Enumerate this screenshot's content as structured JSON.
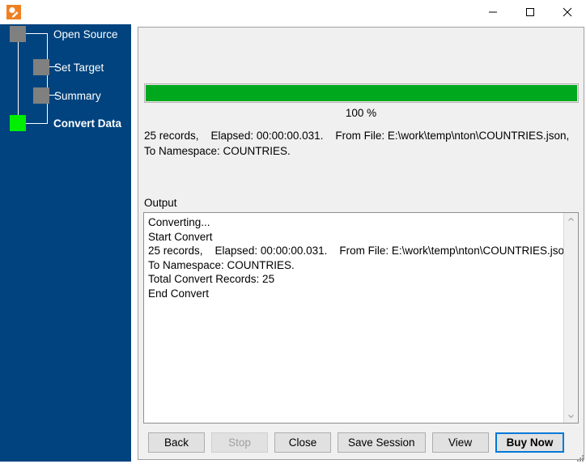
{
  "window": {
    "title": "",
    "icon": "app-edit-icon",
    "controls": {
      "minimize": "minimize-icon",
      "maximize": "maximize-icon",
      "close": "close-icon"
    }
  },
  "sidebar": {
    "background_color": "#00437e",
    "items": [
      {
        "label": "Open Source",
        "state": "done",
        "color": "#808080"
      },
      {
        "label": "Set Target",
        "state": "done",
        "color": "#808080"
      },
      {
        "label": "Summary",
        "state": "done",
        "color": "#808080"
      },
      {
        "label": "Convert Data",
        "state": "active",
        "color": "#00ee00"
      }
    ]
  },
  "main": {
    "progress": {
      "percent_label": "100 %",
      "value": 100,
      "bar_color": "#00a81e"
    },
    "status_text": "25 records,    Elapsed: 00:00:00.031.    From File: E:\\work\\temp\\nton\\COUNTRIES.json,    To Namespace: COUNTRIES.",
    "output_label": "Output",
    "output_log": "Converting...\nStart Convert\n25 records,    Elapsed: 00:00:00.031.    From File: E:\\work\\temp\\nton\\COUNTRIES.json,\nTo Namespace: COUNTRIES.\nTotal Convert Records: 25\nEnd Convert",
    "scrollbar": {
      "up": "scroll-up-icon",
      "down": "scroll-down-icon"
    }
  },
  "buttons": {
    "back": "Back",
    "stop": "Stop",
    "close": "Close",
    "save_session": "Save Session",
    "view": "View",
    "buy_now": "Buy Now"
  }
}
